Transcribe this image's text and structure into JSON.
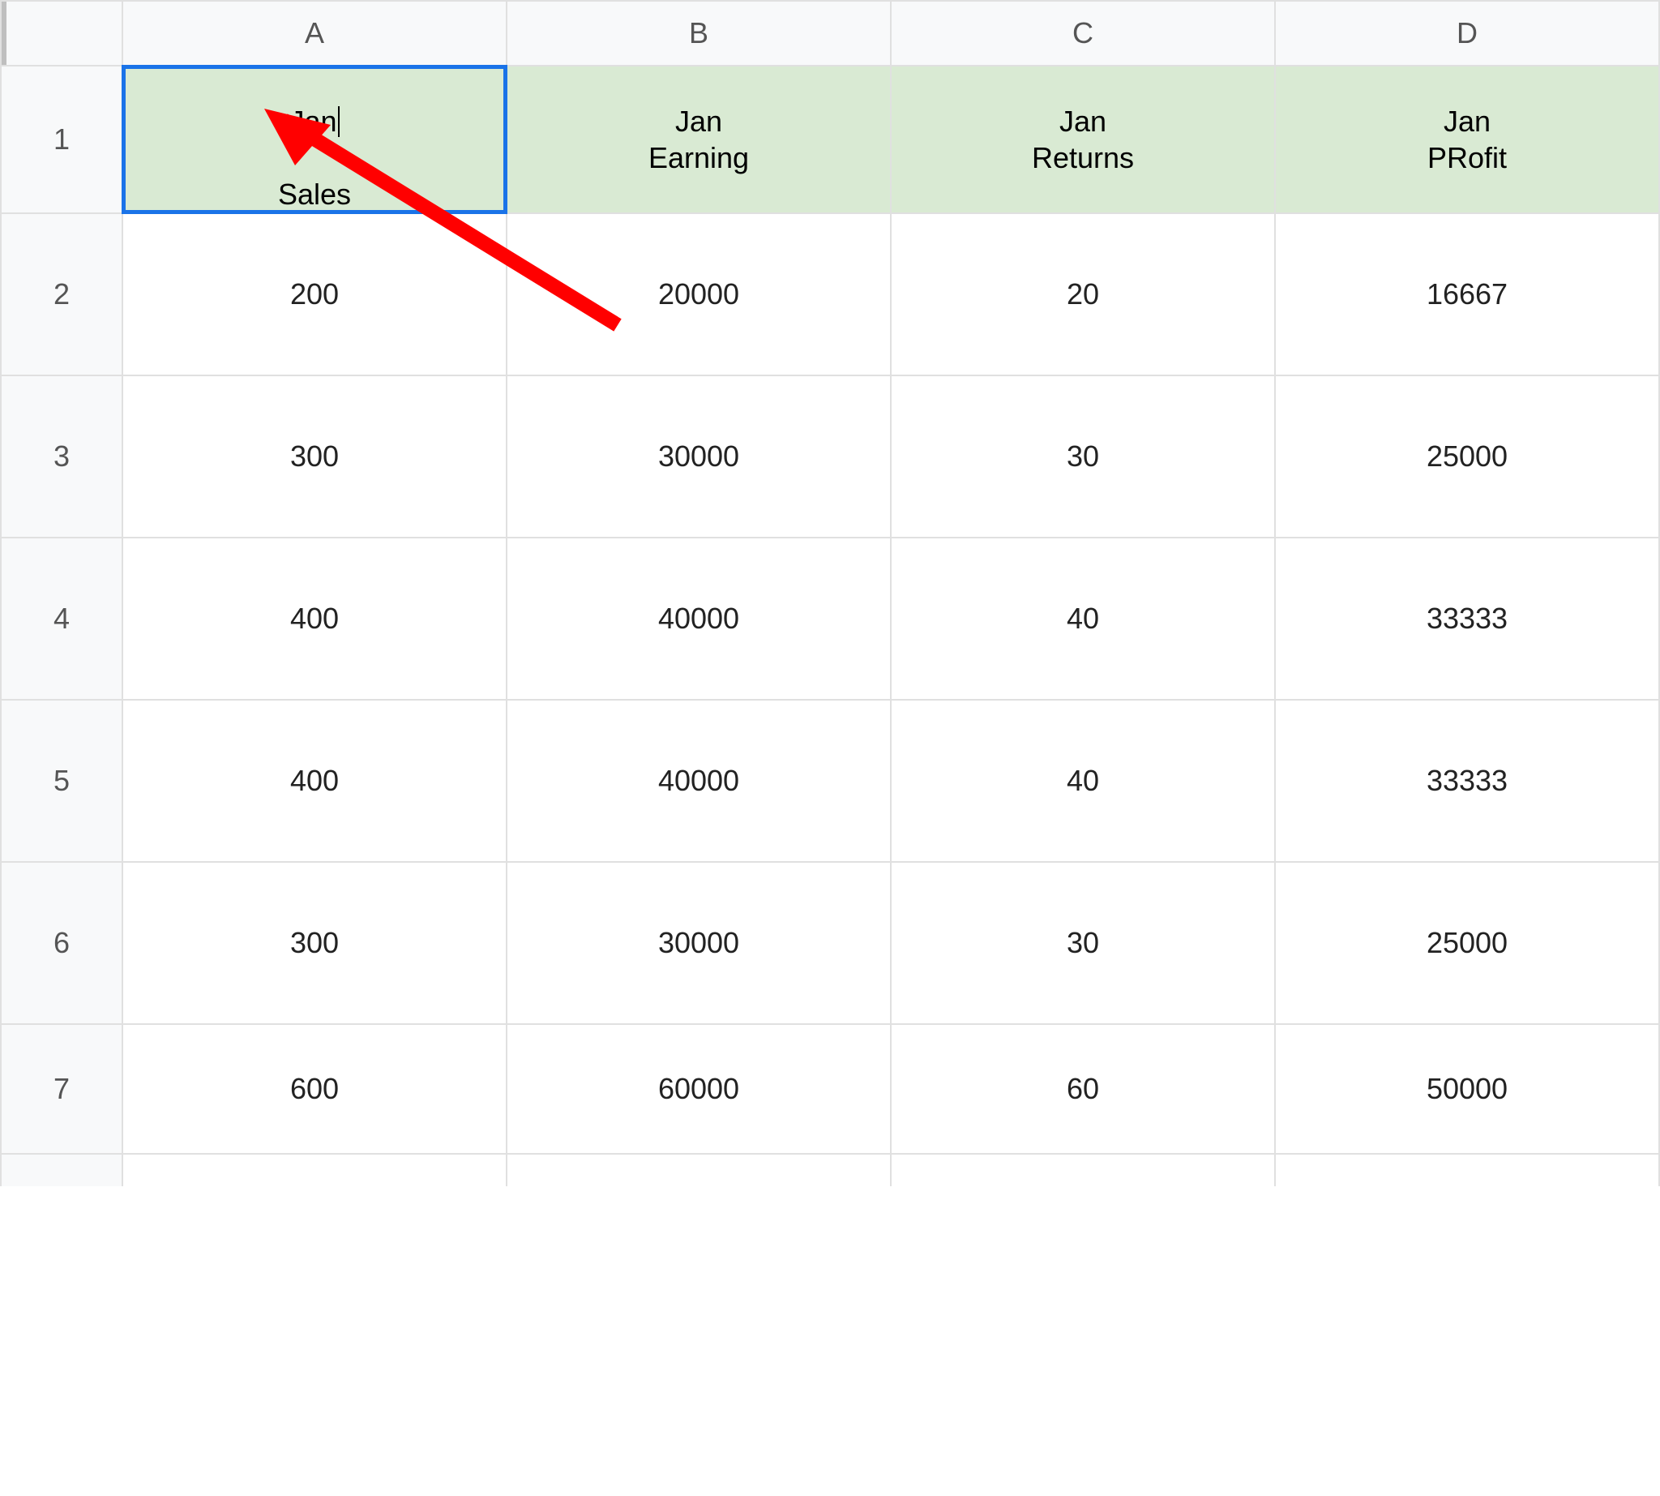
{
  "columns": [
    "A",
    "B",
    "C",
    "D"
  ],
  "row_numbers": [
    "1",
    "2",
    "3",
    "4",
    "5",
    "6",
    "7"
  ],
  "headers": {
    "A": {
      "line1": "Jan",
      "line2": "Sales"
    },
    "B": {
      "line1": "Jan",
      "line2": "Earning"
    },
    "C": {
      "line1": "Jan",
      "line2": "Returns"
    },
    "D": {
      "line1": "Jan",
      "line2": "PRofit"
    }
  },
  "rows": [
    {
      "A": "200",
      "B": "20000",
      "C": "20",
      "D": "16667"
    },
    {
      "A": "300",
      "B": "30000",
      "C": "30",
      "D": "25000"
    },
    {
      "A": "400",
      "B": "40000",
      "C": "40",
      "D": "33333"
    },
    {
      "A": "400",
      "B": "40000",
      "C": "40",
      "D": "33333"
    },
    {
      "A": "300",
      "B": "30000",
      "C": "30",
      "D": "25000"
    },
    {
      "A": "600",
      "B": "60000",
      "C": "60",
      "D": "50000"
    }
  ],
  "active_cell": "A1",
  "annotation": {
    "type": "arrow",
    "color": "#ff0000"
  }
}
